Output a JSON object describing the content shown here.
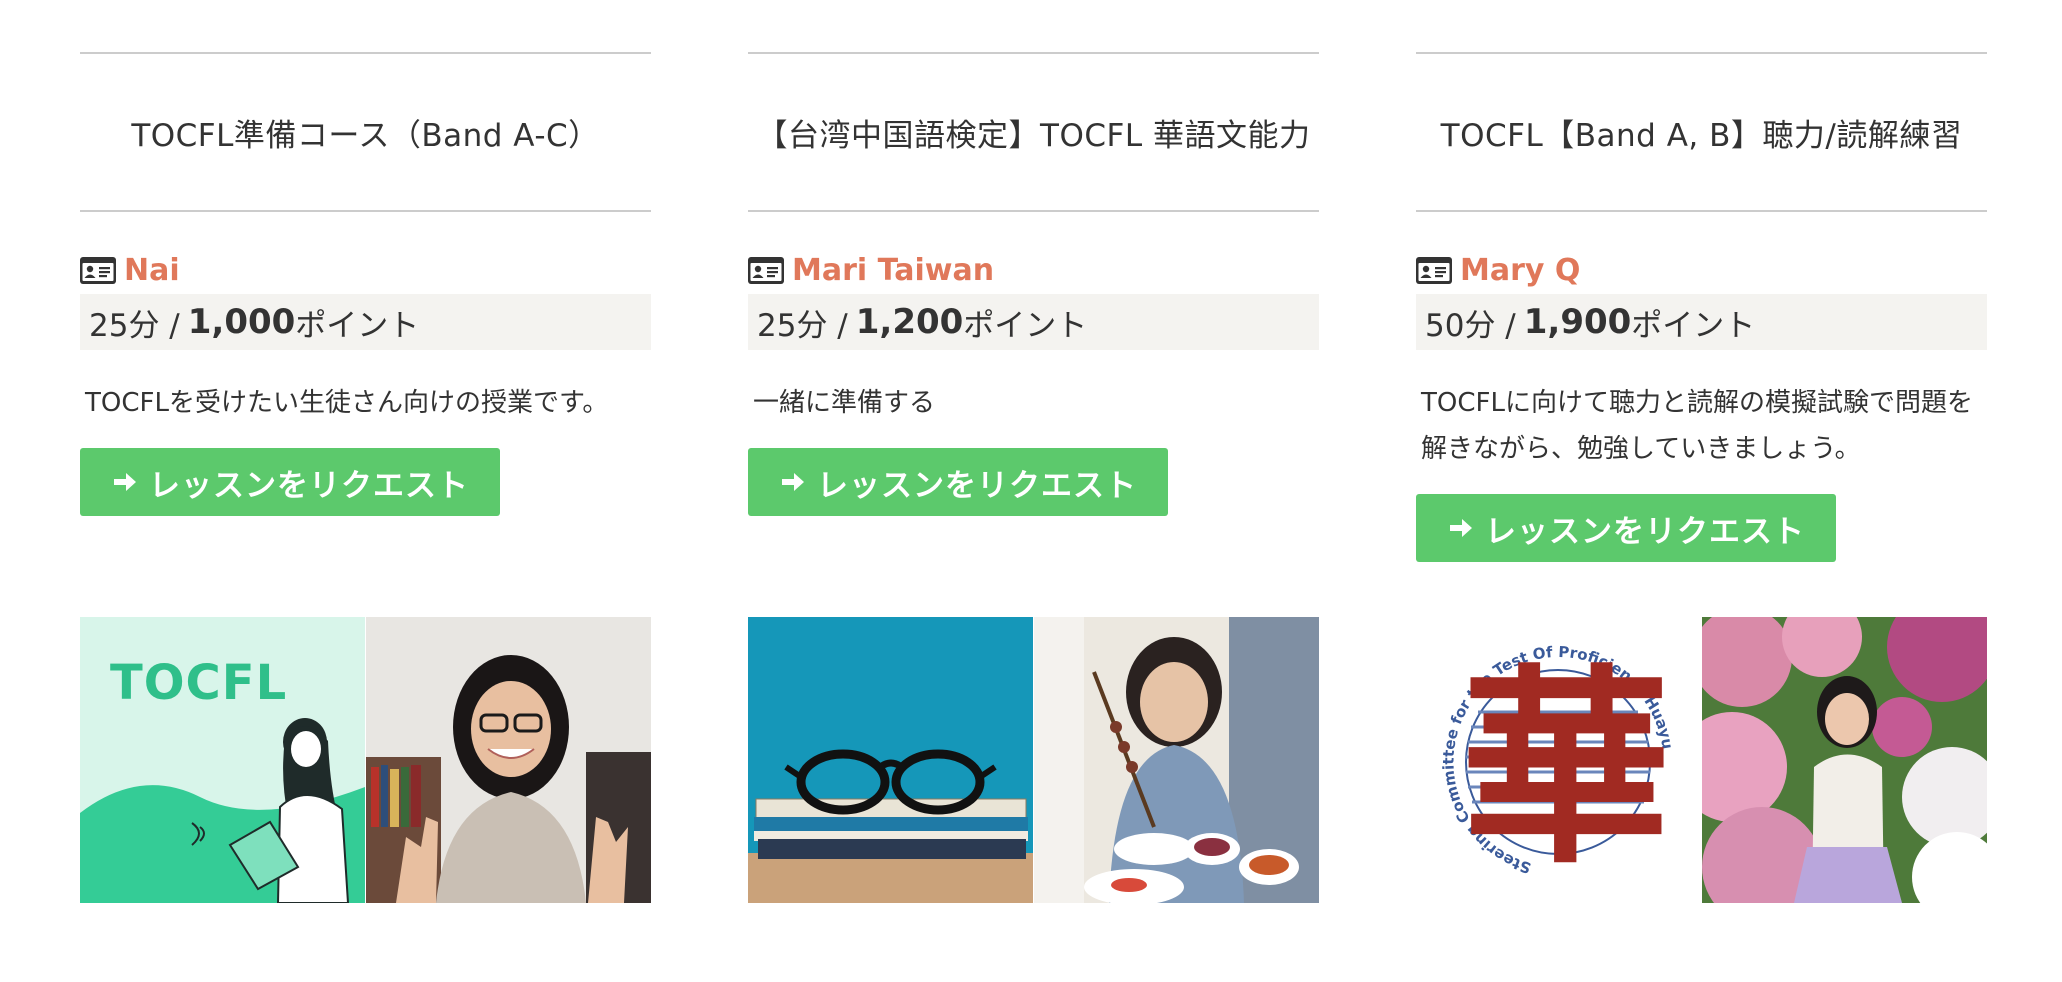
{
  "courses": [
    {
      "title": "TOCFL準備コース（Band A-C）",
      "teacher": "Nai",
      "duration": "25分 /",
      "points": "1,000",
      "points_unit": "ポイント",
      "description": "TOCFLを受けたい生徒さん向けの授業です。",
      "button_label": "レッスンをリクエスト",
      "image_text": "TOCFL"
    },
    {
      "title": "【台湾中国語検定】TOCFL 華語文能力",
      "teacher": "Mari Taiwan",
      "duration": "25分 /",
      "points": "1,200",
      "points_unit": "ポイント",
      "description": "一緒に準備する",
      "button_label": "レッスンをリクエスト"
    },
    {
      "title": "TOCFL【Band A, B】聴力/読解練習",
      "teacher": "Mary Q",
      "duration": "50分 /",
      "points": "1,900",
      "points_unit": "ポイント",
      "description": "TOCFLに向けて聴力と読解の模擬試験で問題を解きながら、勉強していきましょう。",
      "button_label": "レッスンをリクエスト",
      "seal_text": "Steering Committee for the Test Of Proficiency-Huayu",
      "seal_char": "華"
    }
  ],
  "colors": {
    "accent_name": "#e0785a",
    "button_bg": "#5cc96c",
    "price_bg": "#f4f3f0",
    "rule": "#cccccc"
  },
  "icons": {
    "teacher": "id-card-icon",
    "button": "arrow-right-icon"
  }
}
